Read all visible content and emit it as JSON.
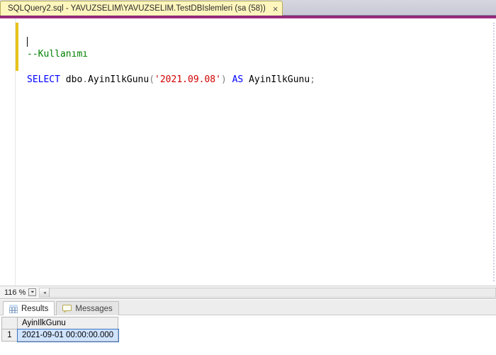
{
  "tab": {
    "title": "SQLQuery2.sql - YAVUZSELIM\\YAVUZSELIM.TestDBIslemleri (sa (58))",
    "close_glyph": "×"
  },
  "editor": {
    "line1_comment": "--Kullanımı",
    "line2_kw_select": "SELECT",
    "line2_plain1": " dbo",
    "line2_gray_dot1": ".",
    "line2_plain2": "AyinIlkGunu",
    "line2_gray_open": "(",
    "line2_string": "'2021.09.08'",
    "line2_gray_close": ")",
    "line2_kw_as": " AS",
    "line2_plain3": " AyinIlkGunu",
    "line2_gray_semi": ";",
    "zoom": "116 %",
    "zoom_caret": "⏷",
    "scroll_caret": "◂"
  },
  "results": {
    "tab_results": "Results",
    "tab_messages": "Messages",
    "col1_header": "AyinIlkGunu",
    "rownum": "1",
    "cell_value": "2021-09-01 00:00:00.000"
  }
}
